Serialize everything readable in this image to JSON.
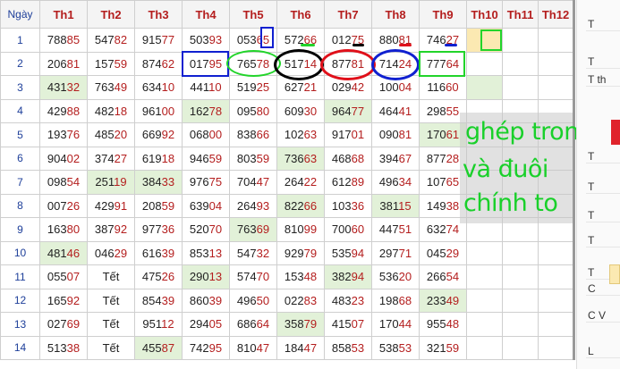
{
  "table": {
    "headers": [
      "Ngày",
      "Th1",
      "Th2",
      "Th3",
      "Th4",
      "Th5",
      "Th6",
      "Th7",
      "Th8",
      "Th9",
      "Th10",
      "Th11",
      "Th12"
    ],
    "rows": [
      {
        "day": "1",
        "cells": [
          "78885",
          "54782",
          "91577",
          "50393",
          "05365",
          "57266",
          "01275",
          "88081",
          "74627",
          "",
          "",
          ""
        ]
      },
      {
        "day": "2",
        "cells": [
          "20681",
          "15759",
          "87462",
          "01795",
          "76578",
          "51714",
          "87781",
          "71424",
          "77764",
          "",
          "",
          ""
        ]
      },
      {
        "day": "3",
        "cells": [
          "43132",
          "76349",
          "63410",
          "44110",
          "51925",
          "62721",
          "02942",
          "10004",
          "11660",
          "",
          "",
          ""
        ]
      },
      {
        "day": "4",
        "cells": [
          "42988",
          "48218",
          "96100",
          "16278",
          "09580",
          "60930",
          "96477",
          "46441",
          "29855",
          "",
          "",
          ""
        ]
      },
      {
        "day": "5",
        "cells": [
          "19376",
          "48520",
          "66992",
          "06800",
          "83866",
          "10263",
          "91701",
          "09081",
          "17061",
          "",
          "",
          ""
        ]
      },
      {
        "day": "6",
        "cells": [
          "90402",
          "37427",
          "61918",
          "94659",
          "80359",
          "73663",
          "46868",
          "39467",
          "87728",
          "",
          "",
          ""
        ]
      },
      {
        "day": "7",
        "cells": [
          "09854",
          "25119",
          "38433",
          "97675",
          "70447",
          "26422",
          "61289",
          "49634",
          "10765",
          "",
          "",
          ""
        ]
      },
      {
        "day": "8",
        "cells": [
          "00726",
          "42991",
          "20859",
          "63904",
          "26493",
          "82266",
          "10336",
          "38115",
          "14938",
          "",
          "",
          ""
        ]
      },
      {
        "day": "9",
        "cells": [
          "16380",
          "38792",
          "97736",
          "52070",
          "76369",
          "81099",
          "70060",
          "44751",
          "63274",
          "",
          "",
          ""
        ]
      },
      {
        "day": "10",
        "cells": [
          "48146",
          "04629",
          "61639",
          "85313",
          "54732",
          "92979",
          "53594",
          "29771",
          "04529",
          "",
          "",
          ""
        ]
      },
      {
        "day": "11",
        "cells": [
          "05507",
          "Tết",
          "47526",
          "29013",
          "57470",
          "15348",
          "38294",
          "53620",
          "26654",
          "",
          "",
          ""
        ]
      },
      {
        "day": "12",
        "cells": [
          "16592",
          "Tết",
          "85439",
          "86039",
          "49650",
          "02283",
          "48323",
          "19868",
          "23349",
          "",
          "",
          ""
        ]
      },
      {
        "day": "13",
        "cells": [
          "02769",
          "Tết",
          "95112",
          "29405",
          "68664",
          "35879",
          "41507",
          "17044",
          "95548",
          "",
          "",
          ""
        ]
      },
      {
        "day": "14",
        "cells": [
          "51338",
          "Tết",
          "45587",
          "74295",
          "81047",
          "18447",
          "85853",
          "53853",
          "32159",
          "",
          "",
          ""
        ]
      }
    ]
  },
  "overlay": {
    "line1": "ghép trong",
    "line2": "và đuôi",
    "line3": "chính to"
  },
  "side_panel": {
    "labels": [
      "T",
      "T",
      "T th",
      "T",
      "T",
      "T",
      "T",
      "T",
      "C",
      "C V",
      "L"
    ]
  },
  "colors": {
    "header_text": "#b41e1e",
    "day_text": "#1e3f9a",
    "highlight_green": "#e2f1d8",
    "highlight_yellow": "#fbe9b2",
    "annotation_blue": "#1020d0",
    "annotation_green": "#22d42a",
    "annotation_red": "#e0101a",
    "annotation_black": "#000000",
    "overlay_text": "#19d02a"
  }
}
